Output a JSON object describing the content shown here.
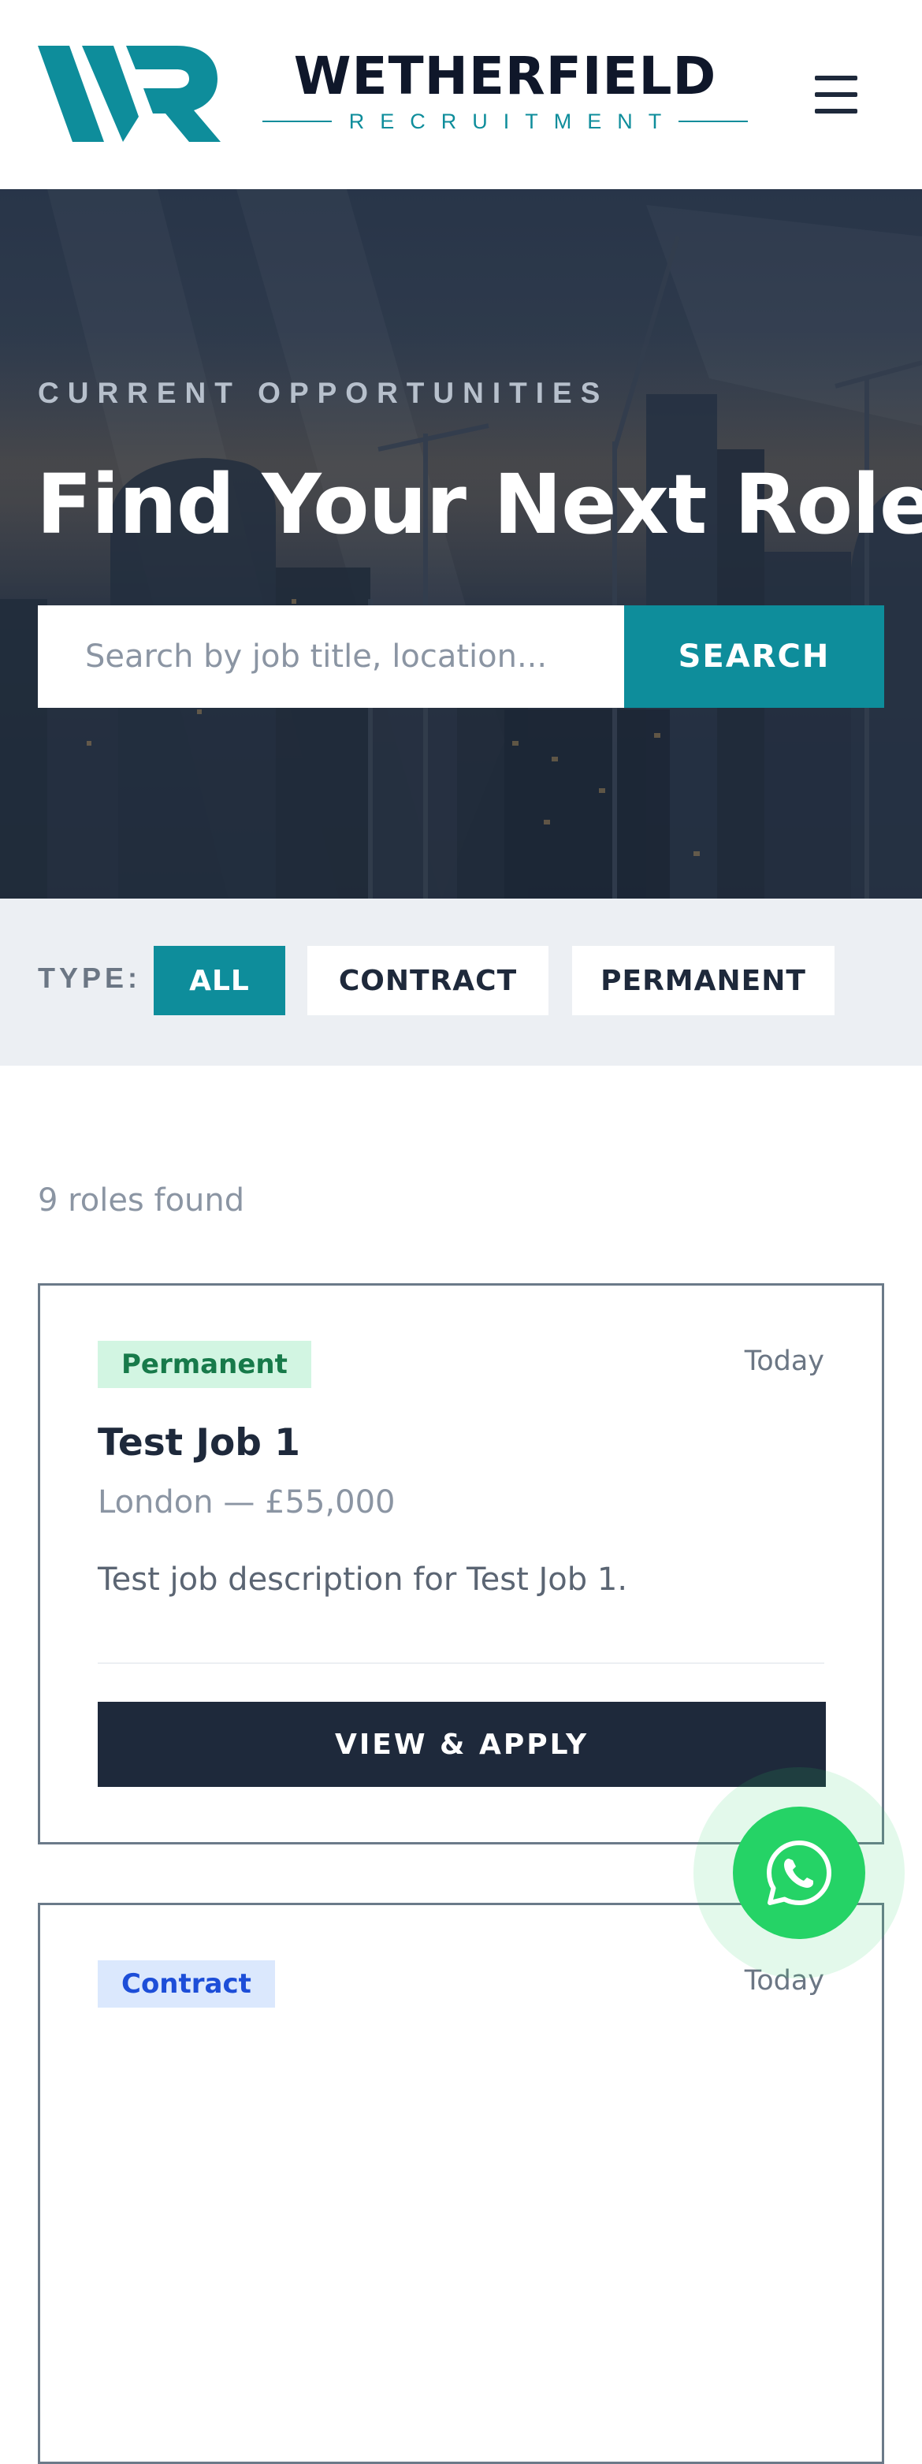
{
  "header": {
    "brand_name": "WETHERFIELD",
    "brand_tagline": "RECRUITMENT",
    "logo_icon": "wr-monogram-logo",
    "menu_icon": "hamburger-menu-icon"
  },
  "hero": {
    "eyebrow": "CURRENT OPPORTUNITIES",
    "title": "Find Your Next Role",
    "search_placeholder": "Search by job title, location...",
    "search_value": "",
    "search_button": "SEARCH"
  },
  "filters": {
    "label": "TYPE:",
    "options": [
      "ALL",
      "CONTRACT",
      "PERMANENT"
    ],
    "selected": "ALL"
  },
  "results": {
    "count_text": "9 roles found",
    "jobs": [
      {
        "type": "Permanent",
        "date": "Today",
        "title": "Test Job 1",
        "meta": "London — £55,000",
        "description": "Test job description for Test Job 1.",
        "cta": "VIEW & APPLY"
      },
      {
        "type": "Contract",
        "date": "Today"
      }
    ]
  },
  "colors": {
    "brand_teal": "#0e8d9b",
    "navy": "#1e293b",
    "whatsapp_green": "#25d366",
    "filter_bg": "#eceff3",
    "permanent_badge_bg": "#d2f5e2",
    "contract_badge_bg": "#dbe8fd"
  },
  "floating": {
    "whatsapp_icon": "whatsapp-icon"
  }
}
